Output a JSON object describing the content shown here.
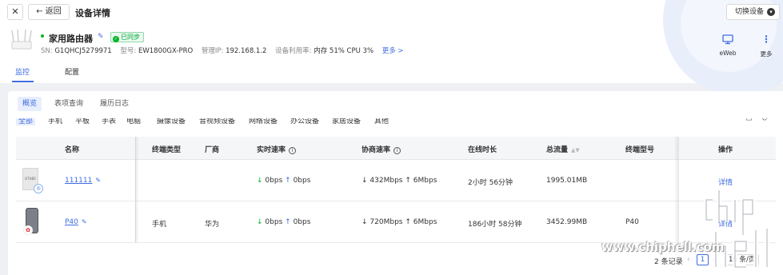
{
  "header": {
    "close_icon": "close-icon",
    "back_label": "返回",
    "title": "设备详情",
    "switch_label": "切换设备"
  },
  "device": {
    "name": "家用路由器",
    "sync_status": "已同步",
    "sn_label": "SN:",
    "sn": "G1QHCJ5279971",
    "model_label": "型号:",
    "model": "EW1800GX-PRO",
    "ip_label": "管理IP:",
    "ip": "192.168.1.2",
    "usage_label": "设备利用率:",
    "memory": "内存 51%",
    "cpu": "CPU 3%",
    "more_link": "更多 >"
  },
  "tools": [
    {
      "label": "eWeb",
      "icon": "monitor-icon"
    },
    {
      "label": "更多",
      "icon": "more-vertical-icon"
    }
  ],
  "tabs": [
    "监控",
    "配置"
  ],
  "subtabs": [
    "概览",
    "表项查询",
    "履历日志"
  ],
  "filters": [
    "全部",
    "手机",
    "平板",
    "手表",
    "电脑",
    "摄像设备",
    "音视频设备",
    "网络设备",
    "办公设备",
    "家居设备",
    "其他"
  ],
  "table": {
    "headers": {
      "name": "名称",
      "type": "终端类型",
      "vendor": "厂商",
      "speed": "实时速率",
      "negotiated": "协商速率",
      "online": "在线时长",
      "traffic": "总流量",
      "model": "终端型号",
      "action": "操作"
    },
    "rows": [
      {
        "name": "111111",
        "type": "",
        "vendor": "",
        "speed_down": "0bps",
        "speed_up": "0bps",
        "neg_down": "432Mbps",
        "neg_up": "6Mbps",
        "online": "2小时 56分钟",
        "traffic": "1995.01MB",
        "model": "",
        "action": "详情",
        "thumb_text": "OTHER"
      },
      {
        "name": "P40",
        "type": "手机",
        "vendor": "华为",
        "speed_down": "0bps",
        "speed_up": "0bps",
        "neg_down": "720Mbps",
        "neg_up": "6Mbps",
        "online": "186小时 58分钟",
        "traffic": "3452.99MB",
        "model": "P40",
        "action": "详情",
        "thumb_text": "HUAWEI"
      }
    ]
  },
  "pagination": {
    "total": "2 条记录",
    "current": "1",
    "page_size": "10 条/页"
  },
  "watermark": "www.chiphell.com",
  "colors": {
    "accent": "#3f6ce0",
    "success": "#00b42a"
  }
}
